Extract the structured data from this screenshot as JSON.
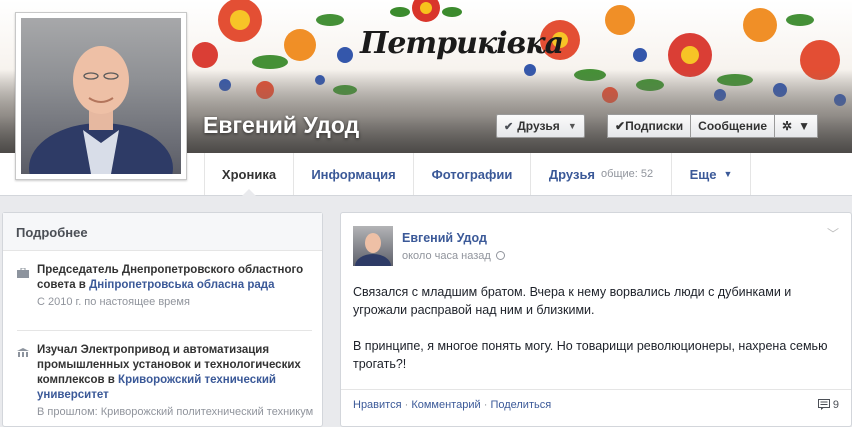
{
  "cover": {
    "logo_text": "Петриківка"
  },
  "profile": {
    "name": "Евгений Удод"
  },
  "header_buttons": {
    "friends": "Друзья",
    "subscriptions": "Подписки",
    "message": "Сообщение"
  },
  "tabs": [
    {
      "label": "Хроника"
    },
    {
      "label": "Информация"
    },
    {
      "label": "Фотографии"
    },
    {
      "label": "Друзья",
      "sub": "общие: 52"
    },
    {
      "label": "Еще"
    }
  ],
  "details": {
    "title": "Подробнее",
    "items": [
      {
        "text_start": "Председатель Днепропетровского областного совета в ",
        "link": "Днiпропетровська обласна рада",
        "meta": "С 2010 г. по настоящее время"
      },
      {
        "text_start": "Изучал Электропривод и автоматизация промышленных установок и технологических комплексов в ",
        "link": "Криворожский технический университет",
        "meta": "В прошлом: Криворожский политехнический техникум"
      }
    ]
  },
  "post": {
    "author": "Евгений Удод",
    "time": "около часа назад",
    "paragraphs": [
      "Связался с младшим братом. Вчера к нему ворвались люди с дубинками и угрожали расправой над ним и близкими.",
      "В принципе, я многое понять могу. Но товарищи революционеры, нахрена семью трогать?!"
    ],
    "actions": {
      "like": "Нравится",
      "comment": "Комментарий",
      "share": "Поделиться"
    },
    "comment_count": "9"
  },
  "colors": {
    "link": "#3b5998",
    "background": "#e9eaed"
  }
}
